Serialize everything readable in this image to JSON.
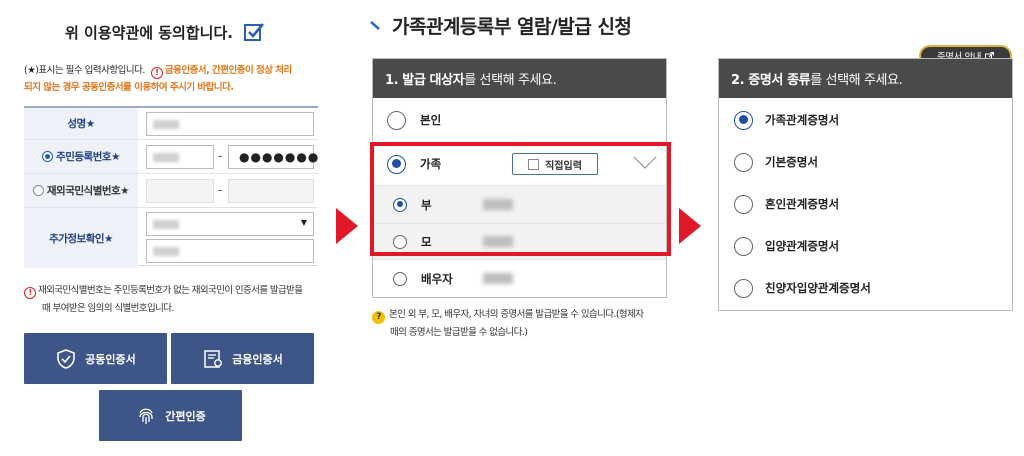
{
  "left": {
    "agree_text": "위 이용약관에 동의합니다.",
    "agree_checked": true,
    "required_note": "(★)표시는 필수 입력사항입니다.",
    "orange_note_1": "금융인증서, 간편인증이 정상 처리",
    "orange_note_2": "되지 않는 경우 공동인증서를 이용하여 주시기 바랍니다.",
    "form": {
      "name_label": "성명★",
      "rrn_label": "주민등록번호★",
      "rrn_hidden": "●●●●●●●",
      "foreign_label": "재외국민식별번호★",
      "extra_label": "추가정보확인★",
      "dash": "-"
    },
    "foreign_note_1": "재외국민식별번호는 주민등록번호가 없는 재외국민이 인증서를 발급받을",
    "foreign_note_2": "때 부여받은 임의의 식별번호입니다.",
    "buttons": {
      "joint_cert": "공동인증서",
      "finance_cert": "금융인증서",
      "simple_auth": "간편인증"
    }
  },
  "middle": {
    "title": "가족관계등록부 열람/발급 신청",
    "header_bold": "1. 발급 대상자",
    "header_rest": "를 선택해 주세요.",
    "options": {
      "self": "본인",
      "family": "가족",
      "father": "부",
      "mother": "모",
      "spouse": "배우자"
    },
    "direct_input": "직접입력",
    "help_1": "본인 외 부, 모, 배우자, 자녀의 증명서를 발급받을 수 있습니다.(형제자",
    "help_2": "매의 증명서는 발급받을 수 없습니다.)"
  },
  "right": {
    "badge": "증명서 안내",
    "header_bold": "2. 증명서 종류",
    "header_rest": "를 선택해 주세요.",
    "certs": [
      "가족관계증명서",
      "기본증명서",
      "혼인관계증명서",
      "입양관계증명서",
      "친양자입양관계증명서"
    ],
    "selected_index": 0
  },
  "colors": {
    "navy_button": "#3e5588",
    "highlight_red": "#e0182a",
    "panel_header": "#4a4a4a",
    "accent_blue": "#1f4fa8",
    "orange": "#e0781e"
  }
}
